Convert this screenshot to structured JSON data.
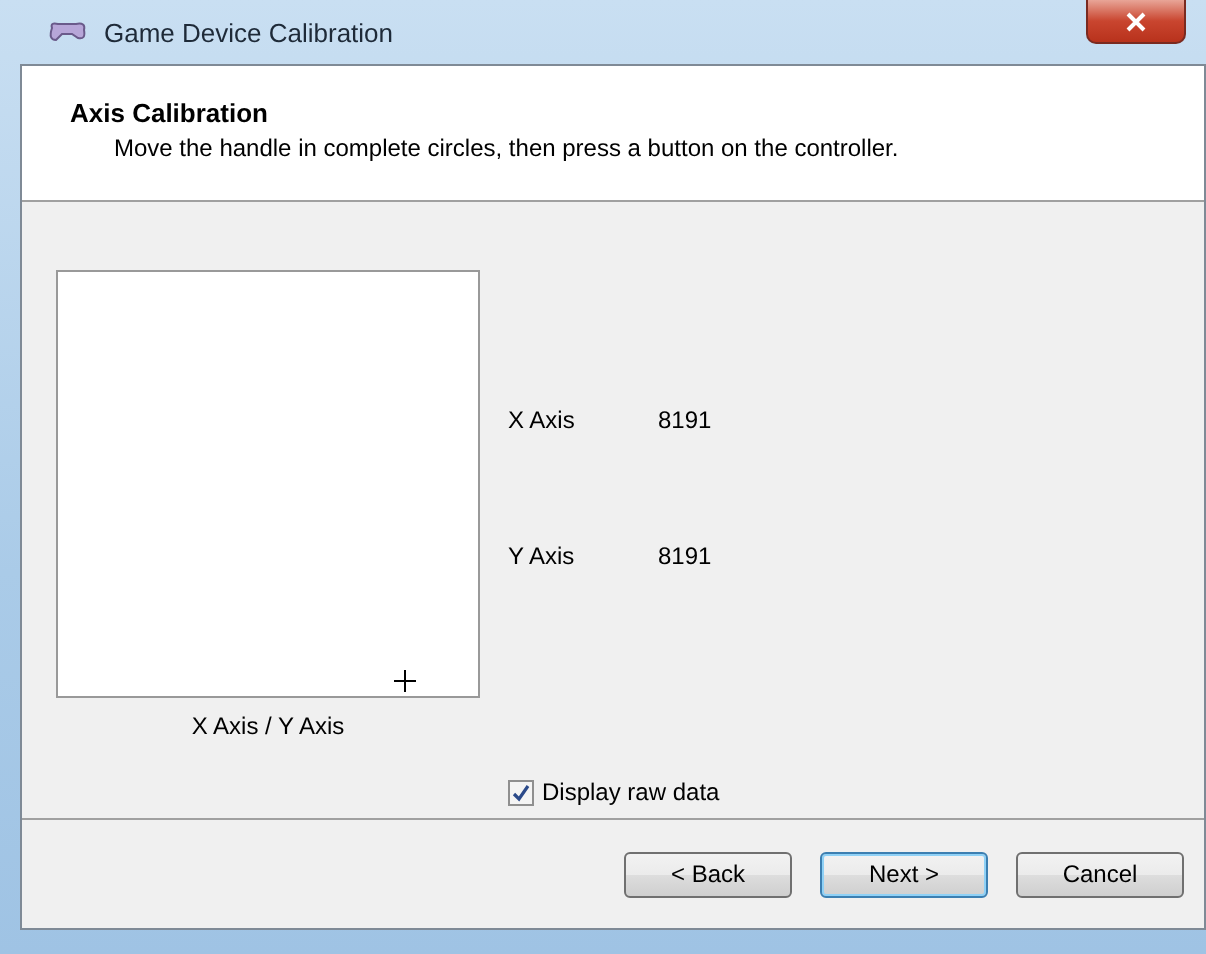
{
  "window": {
    "title": "Game Device Calibration"
  },
  "header": {
    "title": "Axis Calibration",
    "subtitle": "Move the handle in complete circles, then press a button on the controller."
  },
  "plot": {
    "caption": "X Axis / Y Axis"
  },
  "readings": [
    {
      "label": "X Axis",
      "value": "8191"
    },
    {
      "label": "Y Axis",
      "value": "8191"
    }
  ],
  "raw_data": {
    "label": "Display raw data",
    "checked": true
  },
  "buttons": [
    {
      "label": "< Back",
      "selected": false
    },
    {
      "label": "Next >",
      "selected": true
    },
    {
      "label": "Cancel",
      "selected": false
    }
  ]
}
